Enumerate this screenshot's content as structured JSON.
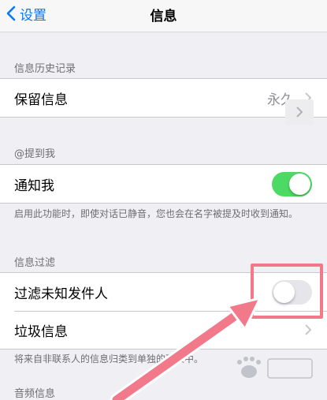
{
  "navbar": {
    "back_label": "设置",
    "title": "信息"
  },
  "history": {
    "header": "信息历史记录",
    "row_label": "保留信息",
    "row_value": "永久"
  },
  "mention": {
    "header": "@提到我",
    "row_label": "通知我",
    "toggle_on": true,
    "footer": "启用此功能时，即使对话已静音，您也会在名字被提及时收到通知。"
  },
  "filter": {
    "header": "信息过滤",
    "unknown_label": "过滤未知发件人",
    "unknown_on": false,
    "junk_label": "垃圾信息",
    "footer": "将来自非联系人的信息归类到单独的列表中。"
  },
  "audio": {
    "header": "音频信息"
  },
  "colors": {
    "accent": "#007aff",
    "toggle_on": "#4cd964",
    "annotation": "#f2798a"
  },
  "icons": {
    "back": "chevron-left-icon",
    "row": "chevron-right-icon",
    "annotation": "arrow-icon"
  }
}
